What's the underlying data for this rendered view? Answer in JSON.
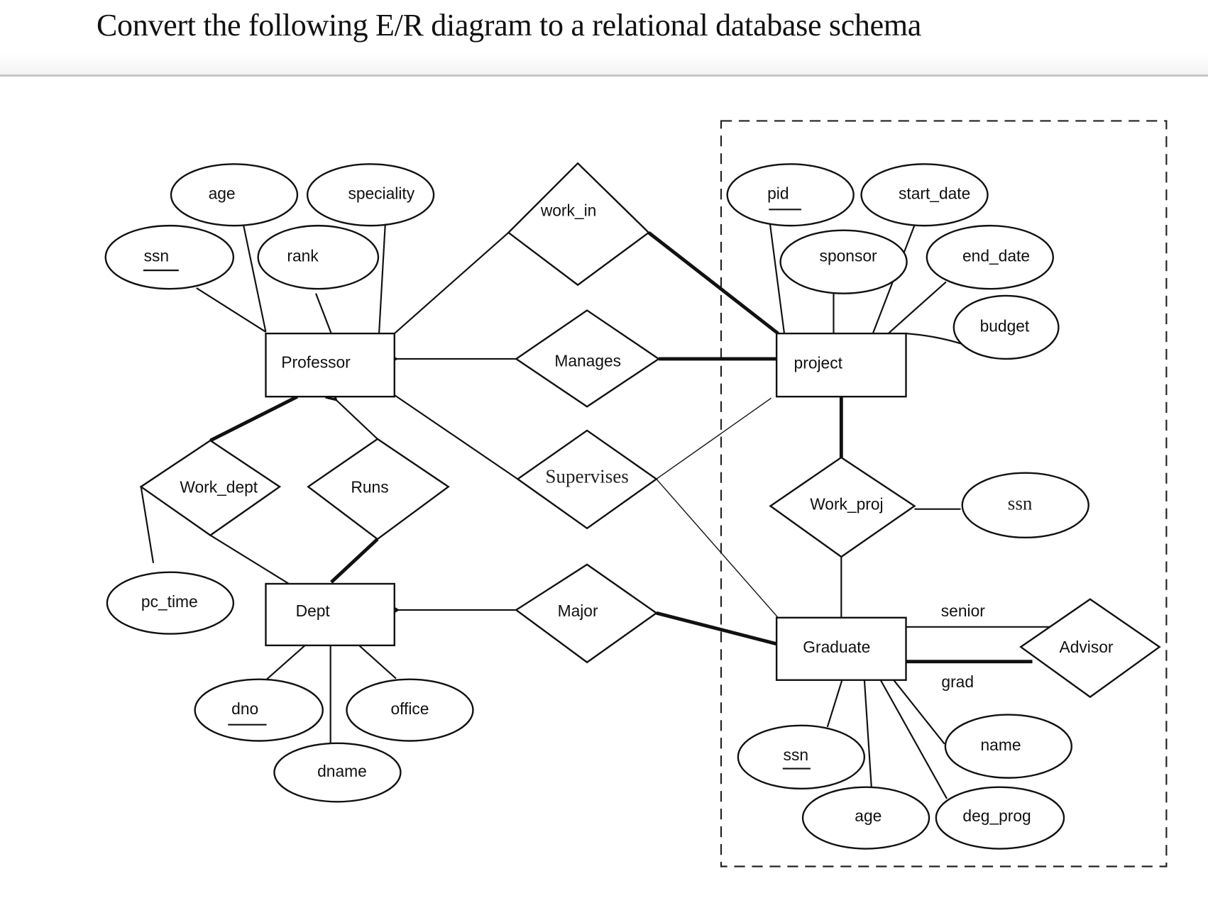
{
  "page": {
    "title": "Convert the following E/R diagram to a relational database schema"
  },
  "diagram": {
    "entities": [
      {
        "id": "professor",
        "label": "Professor",
        "attributes": [
          "ssn",
          "age",
          "rank",
          "speciality"
        ],
        "key": "ssn"
      },
      {
        "id": "dept",
        "label": "Dept",
        "attributes": [
          "dno",
          "dname",
          "office"
        ],
        "key": "dno"
      },
      {
        "id": "project",
        "label": "project",
        "attributes": [
          "pid",
          "sponsor",
          "start_date",
          "end_date",
          "budget"
        ],
        "key": "pid"
      },
      {
        "id": "graduate",
        "label": "Graduate",
        "attributes": [
          "ssn",
          "age",
          "name",
          "deg_prog"
        ],
        "key": "ssn"
      }
    ],
    "relationships": [
      {
        "id": "work_in",
        "label": "work_in",
        "connects": [
          "Professor",
          "project"
        ]
      },
      {
        "id": "manages",
        "label": "Manages",
        "connects": [
          "Professor",
          "project"
        ]
      },
      {
        "id": "supervises",
        "label": "Supervises",
        "connects": [
          "Professor",
          "project",
          "Graduate"
        ]
      },
      {
        "id": "work_dept",
        "label": "Work_dept",
        "connects": [
          "Professor",
          "Dept"
        ],
        "attributes": [
          "pc_time"
        ]
      },
      {
        "id": "runs",
        "label": "Runs",
        "connects": [
          "Professor",
          "Dept"
        ]
      },
      {
        "id": "major",
        "label": "Major",
        "connects": [
          "Graduate",
          "Dept"
        ]
      },
      {
        "id": "work_proj",
        "label": "Work_proj",
        "connects": [
          "project",
          "Graduate"
        ],
        "attributes": [
          "ssn"
        ]
      },
      {
        "id": "advisor",
        "label": "Advisor",
        "connects": [
          "Graduate",
          "Graduate"
        ],
        "roles": [
          "senior",
          "grad"
        ]
      }
    ],
    "labels": {
      "professor": "Professor",
      "dept": "Dept",
      "project": "project",
      "graduate": "Graduate",
      "work_in": "work_in",
      "manages": "Manages",
      "supervises": "Supervises",
      "work_dept": "Work_dept",
      "runs": "Runs",
      "major": "Major",
      "work_proj": "Work_proj",
      "advisor": "Advisor",
      "role_senior": "senior",
      "role_grad": "grad",
      "prof_ssn": "ssn",
      "prof_age": "age",
      "prof_rank": "rank",
      "prof_speciality": "speciality",
      "pc_time": "pc_time",
      "dept_dno": "dno",
      "dept_dname": "dname",
      "dept_office": "office",
      "proj_pid": "pid",
      "proj_start_date": "start_date",
      "proj_sponsor": "sponsor",
      "proj_end_date": "end_date",
      "proj_budget": "budget",
      "work_proj_ssn": "ssn",
      "grad_ssn": "ssn",
      "grad_age": "age",
      "grad_name": "name",
      "grad_deg_prog": "deg_prog"
    }
  }
}
